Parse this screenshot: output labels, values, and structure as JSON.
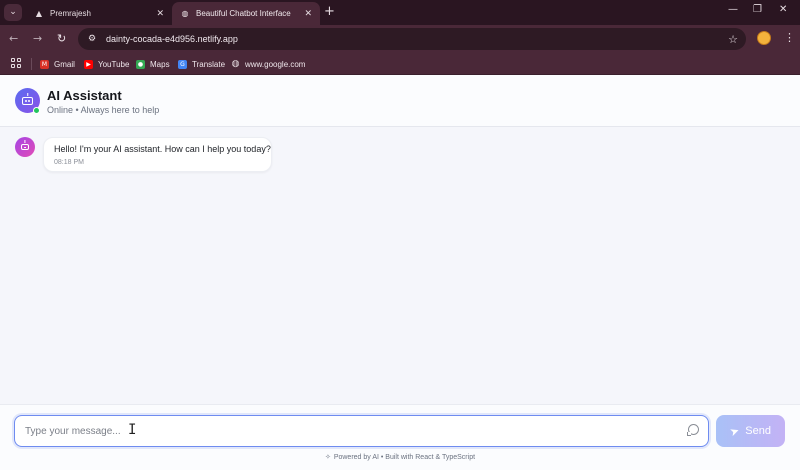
{
  "browser": {
    "tabs": [
      {
        "label": "Premrajesh",
        "icon": "vercel-triangle-icon",
        "active": false
      },
      {
        "label": "Beautiful Chatbot Interface",
        "icon": "globe-icon",
        "active": true
      }
    ],
    "url": "dainty-cocada-e4d956.netlify.app",
    "bookmarks": [
      {
        "label": "Gmail",
        "icon": "gmail-icon",
        "color": "#d93025"
      },
      {
        "label": "YouTube",
        "icon": "youtube-icon",
        "color": "#ff0000"
      },
      {
        "label": "Maps",
        "icon": "maps-icon",
        "color": "#34a853"
      },
      {
        "label": "Translate",
        "icon": "translate-icon",
        "color": "#4285f4"
      },
      {
        "label": "www.google.com",
        "icon": "globe-icon",
        "color": "#9aa0a6"
      }
    ]
  },
  "chat": {
    "title": "AI Assistant",
    "status": "Online • Always here to help",
    "messages": [
      {
        "sender": "bot",
        "text": "Hello! I'm your AI assistant. How can I help you today?",
        "time": "08:18 PM"
      }
    ],
    "input": {
      "value": "",
      "placeholder": "Type your message..."
    },
    "send_label": "Send",
    "footer": "Powered by AI • Built with React & TypeScript"
  },
  "colors": {
    "accent": "#6f8cf0",
    "online": "#22c55e",
    "bot_avatar": "#a445e6"
  }
}
